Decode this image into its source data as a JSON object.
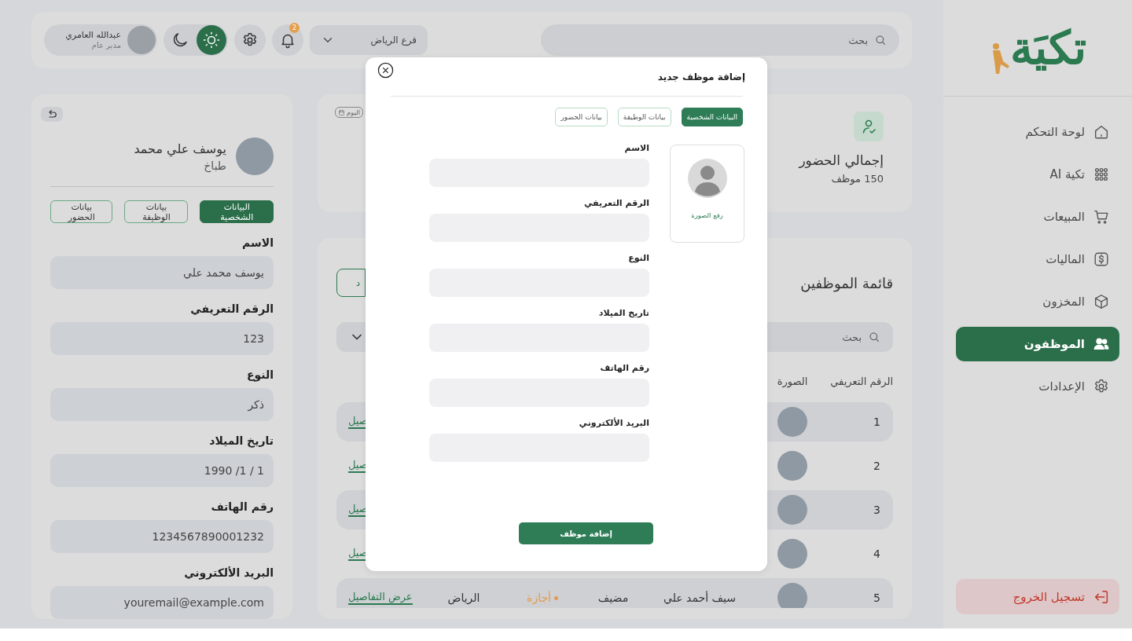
{
  "sidebar": {
    "logo": "تكيَة",
    "nav": [
      {
        "label": "لوحة التحكم",
        "selected": false
      },
      {
        "label": "تكية AI",
        "selected": false
      },
      {
        "label": "المبيعات",
        "selected": false
      },
      {
        "label": "الماليات",
        "selected": false
      },
      {
        "label": "المخزون",
        "selected": false
      },
      {
        "label": "الموظفون",
        "selected": true
      },
      {
        "label": "الإعدادات",
        "selected": false
      }
    ],
    "logout": "تسجيل الخروج"
  },
  "topbar": {
    "search": {
      "placeholder": "بحث"
    },
    "branch": "فرع الرياض",
    "notifications": "2",
    "theme": [
      {
        "kind": "sun",
        "selected": true
      },
      {
        "kind": "moon",
        "selected": false
      }
    ],
    "user": {
      "name": "عبدالله العامري",
      "role": "مدير عام"
    }
  },
  "attendance": {
    "period": "اليوم",
    "title": "إجمالي الحضور",
    "count": "150 موظف"
  },
  "employees": {
    "title": "قائمة الموظفين",
    "add_button": "د",
    "search": {
      "placeholder": "بحث"
    },
    "columns": [
      "الرقم التعريفي",
      "الصورة"
    ],
    "rows": [
      {
        "id": "1",
        "action": "صيل"
      },
      {
        "id": "2",
        "action": "صيل"
      },
      {
        "id": "3",
        "action": "صيل"
      },
      {
        "id": "4",
        "action": "صيل"
      },
      {
        "id": "5",
        "name": "سيف أحمد علي",
        "job": "مضيف",
        "status": {
          "label": "أجازة",
          "color": "#e39a4c"
        },
        "branch": "الرياض",
        "action": "عرض التفاصيل"
      }
    ]
  },
  "profile": {
    "name": "يوسف علي محمد",
    "role": "طباخ",
    "tabs": [
      {
        "label": "البيانات الشخصية",
        "selected": true
      },
      {
        "label": "بيانات الوظيفة",
        "selected": false
      },
      {
        "label": "بيانات الحضور",
        "selected": false
      }
    ],
    "fields": [
      {
        "label": "الاسم",
        "value": "يوسف محمد علي"
      },
      {
        "label": "الرقم التعريفي",
        "value": "123"
      },
      {
        "label": "النوع",
        "value": "ذكر"
      },
      {
        "label": "تاريخ الميلاد",
        "value": "1 / 1/ 1990"
      },
      {
        "label": "رقم الهاتف",
        "value": "1234567890001232"
      },
      {
        "label": "البريد الألكتروني",
        "value": "youremail@example.com"
      }
    ]
  },
  "modal": {
    "title": "إضافة موظف جديد",
    "tabs": [
      {
        "label": "البيانات الشخصية",
        "selected": true
      },
      {
        "label": "بيانات الوظيفة",
        "selected": false
      },
      {
        "label": "بيانات الحضور",
        "selected": false
      }
    ],
    "photo_label": "رفع الصورة",
    "fields": [
      {
        "label": "الاسم"
      },
      {
        "label": "الرقم التعريفي"
      },
      {
        "label": "النوع"
      },
      {
        "label": "تاريخ الميلاد"
      },
      {
        "label": "رقم الهاتف"
      },
      {
        "label": "البريد الألكتروني"
      }
    ],
    "submit": "إضافة موظف"
  }
}
